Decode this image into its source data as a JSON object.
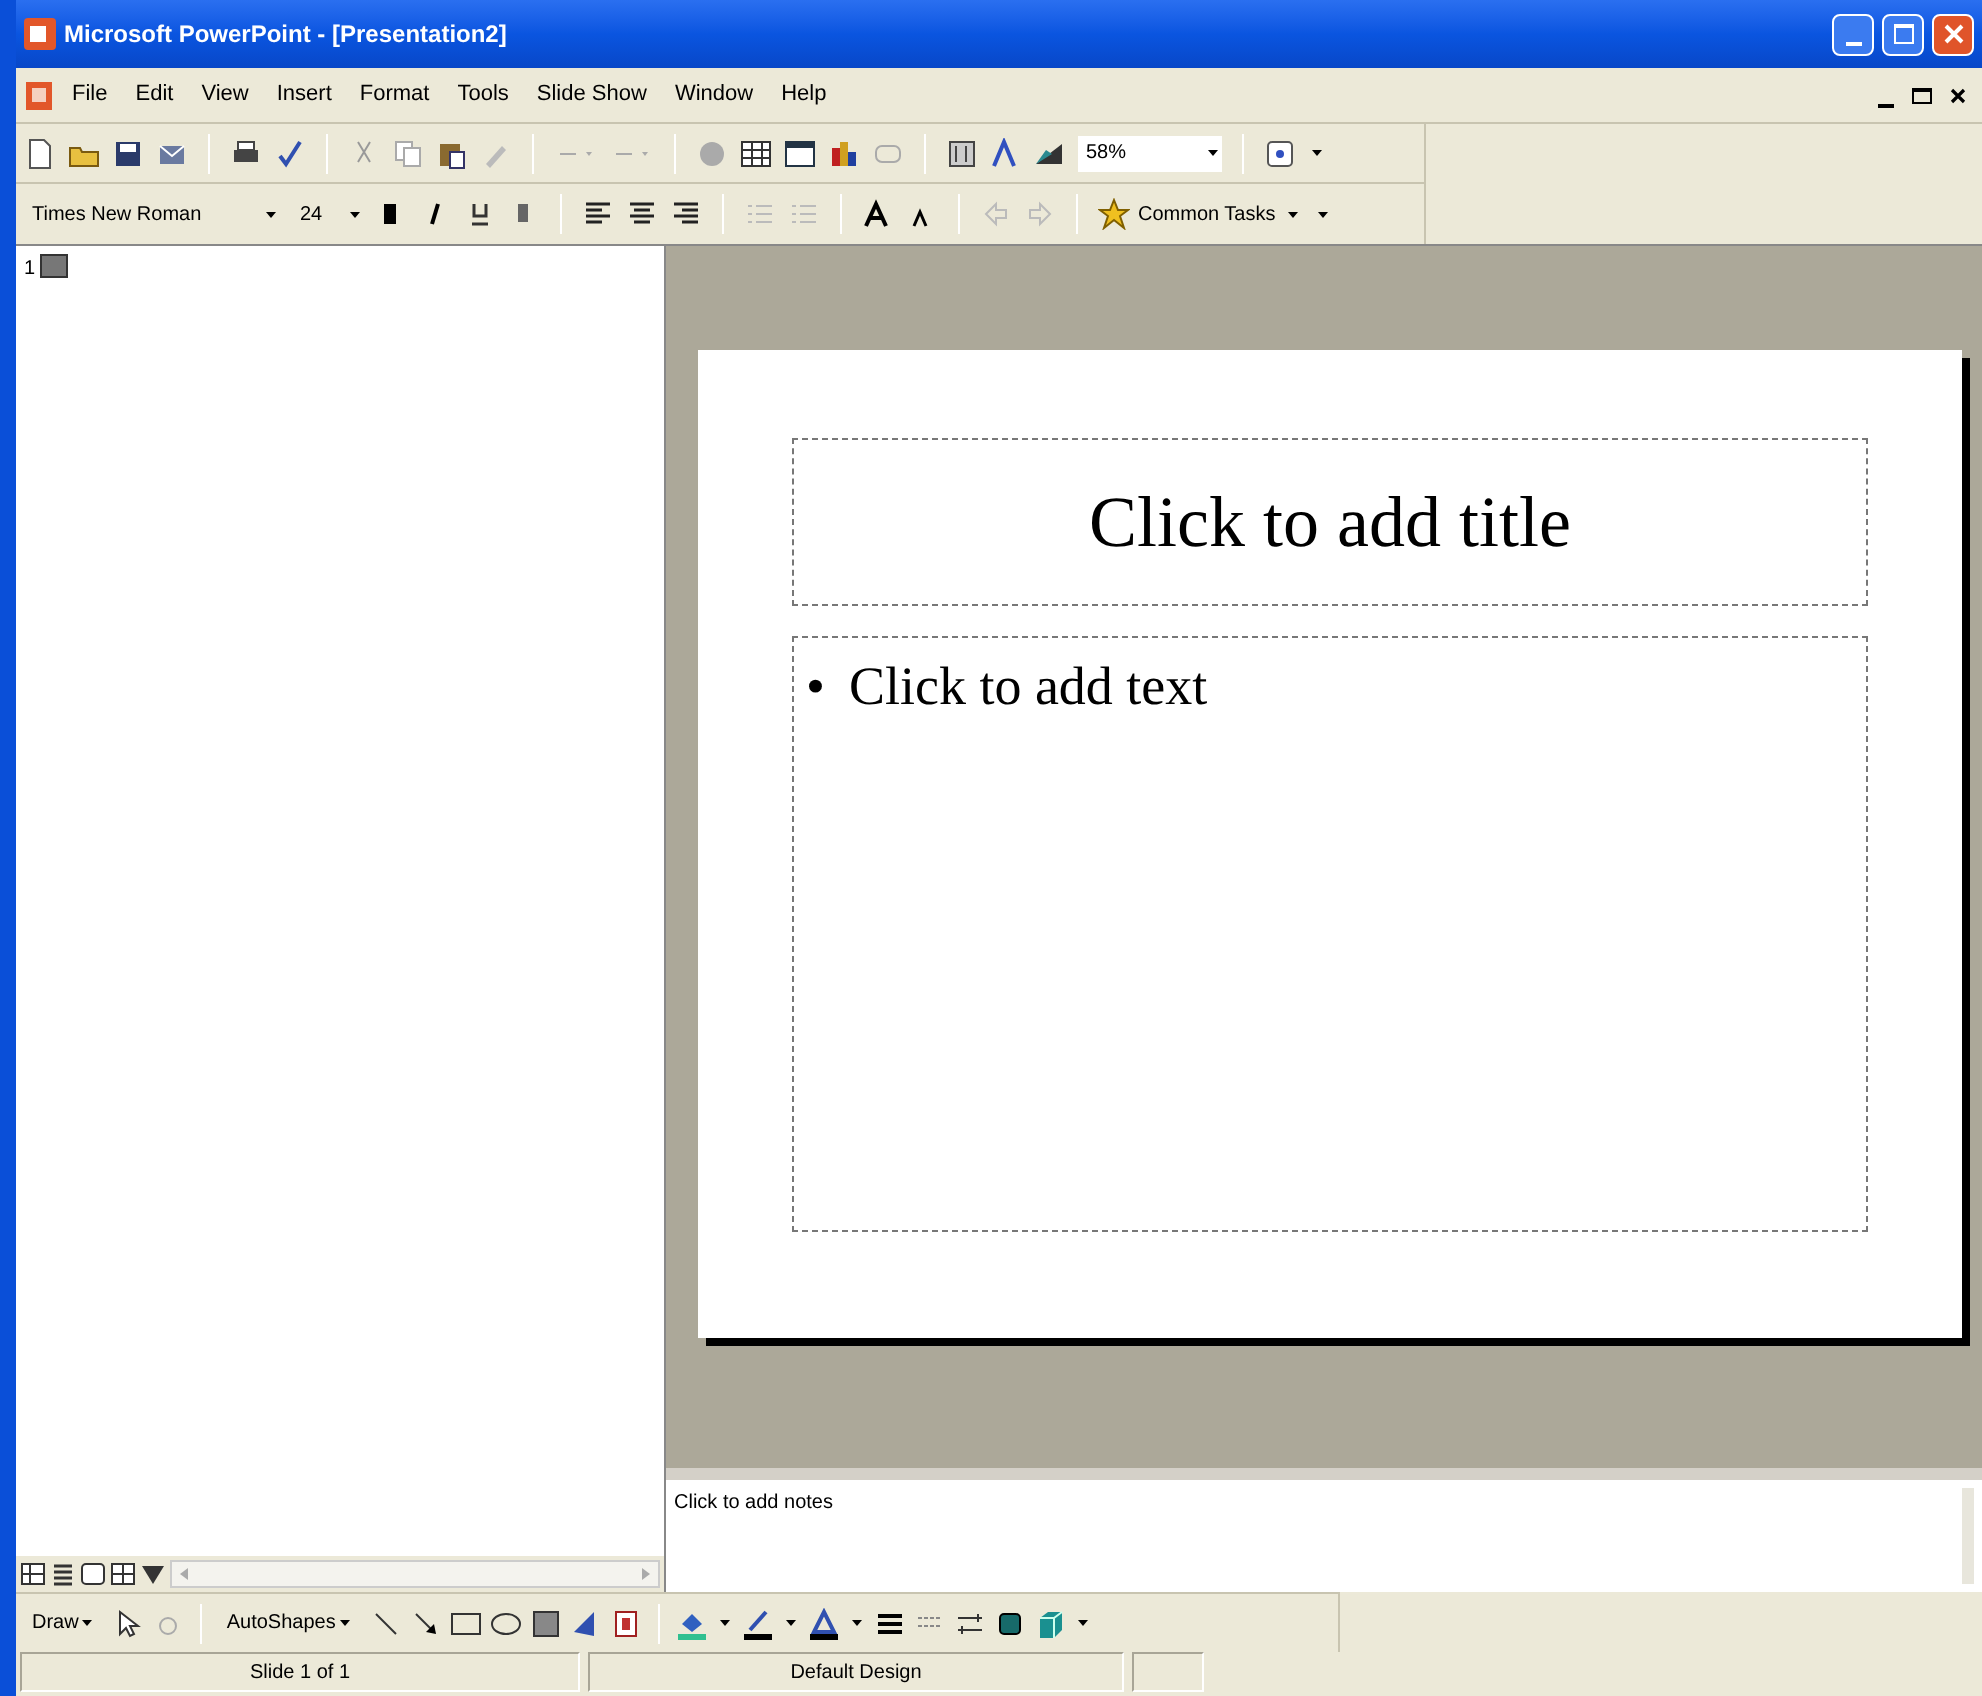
{
  "window": {
    "title": "Microsoft PowerPoint - [Presentation2]"
  },
  "menu": [
    "File",
    "Edit",
    "View",
    "Insert",
    "Format",
    "Tools",
    "Slide Show",
    "Window",
    "Help"
  ],
  "formatting": {
    "font": "Times New Roman",
    "size": "24",
    "zoom": "58%",
    "common_tasks": "Common Tasks"
  },
  "outline": {
    "slide_number": "1"
  },
  "slide": {
    "title_placeholder": "Click to add title",
    "bullet": "•",
    "body_placeholder": "Click to add text"
  },
  "notes": {
    "placeholder": "Click to add notes"
  },
  "drawing_toolbar": {
    "draw": "Draw",
    "autoshapes": "AutoShapes"
  },
  "status_bar": [
    "Slide 1 of 1",
    "Default Design"
  ]
}
